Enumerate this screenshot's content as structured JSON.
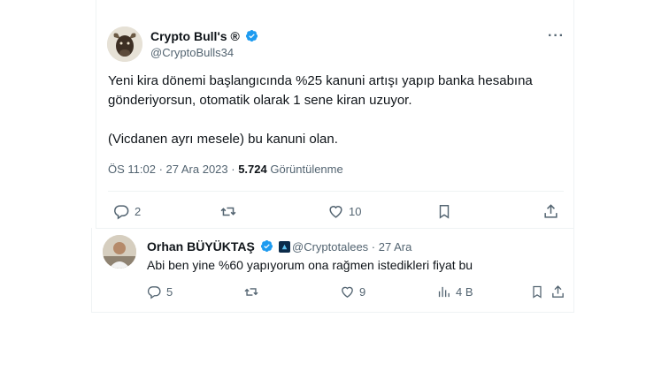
{
  "main_tweet": {
    "author_name": "Crypto Bull's ®",
    "handle": "@CryptoBulls34",
    "more": "···",
    "text_line1": "Yeni kira dönemi başlangıcında %25 kanuni artışı yapıp banka hesabına",
    "text_line2": "gönderiyorsun, otomatik olarak 1 sene kiran uzuyor.",
    "text_line3": "(Vicdanen ayrı mesele) bu kanuni olan.",
    "timestamp": "ÖS 11:02 · 27 Ara 2023 · ",
    "views_count": "5.724",
    "views_label": " Görüntülenme",
    "actions": {
      "replies": "2",
      "retweets": "",
      "likes": "10"
    }
  },
  "reply": {
    "author_name": "Orhan BÜYÜKTAŞ",
    "handle_date": "@Cryptotalees · 27 Ara",
    "text": "Abi ben yine %60 yapıyorum ona rağmen istedikleri fiyat bu",
    "actions": {
      "replies": "5",
      "retweets": "",
      "likes": "9",
      "views": "4 B"
    }
  },
  "colors": {
    "verified": "#1d9bf0",
    "text": "#0f1419",
    "muted": "#536471",
    "divider": "#eff3f4"
  }
}
